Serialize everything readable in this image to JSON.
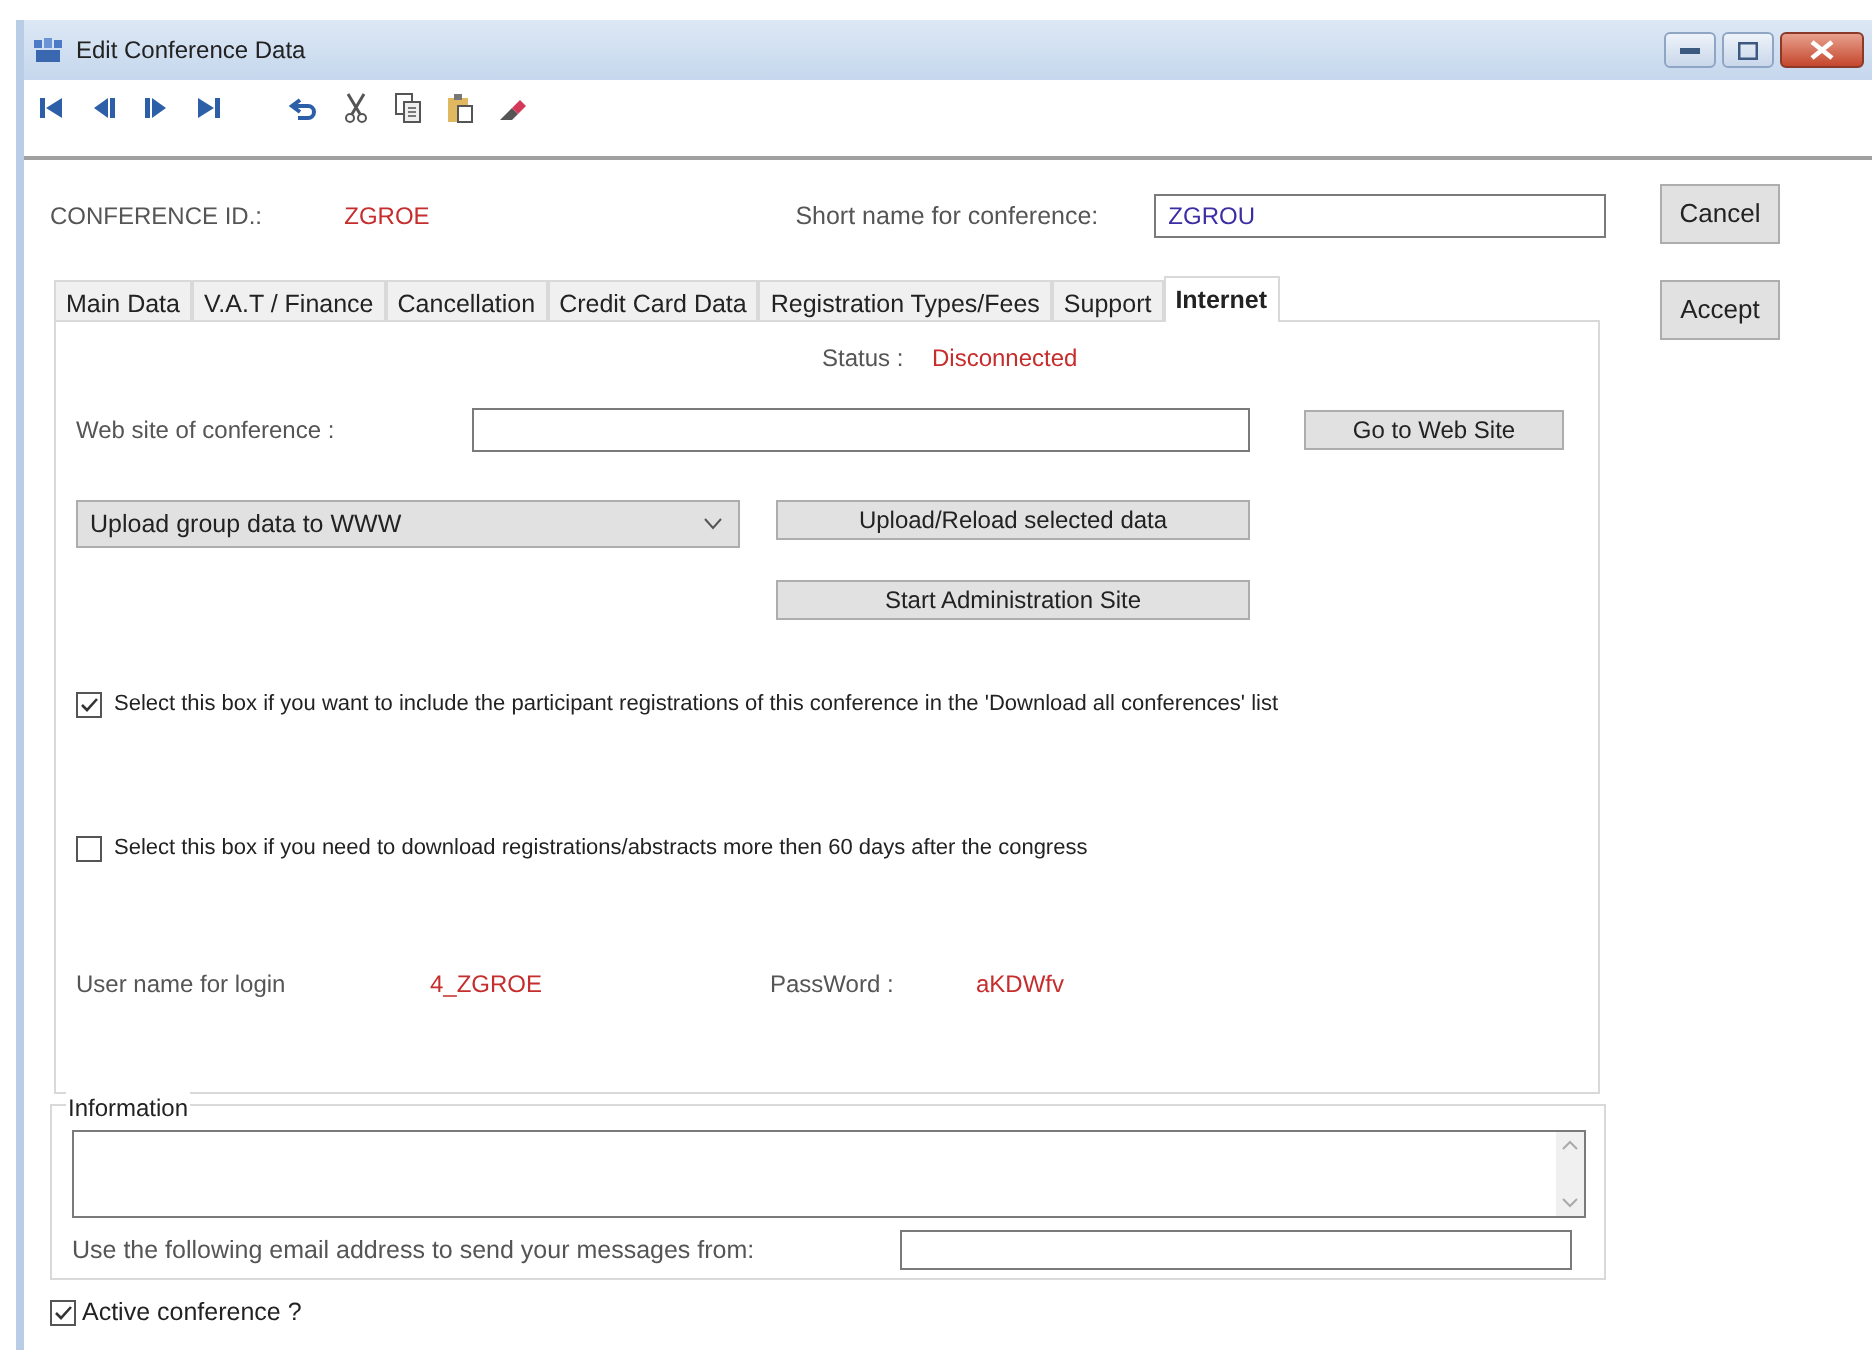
{
  "window": {
    "title": "Edit Conference Data"
  },
  "header": {
    "id_label": "CONFERENCE ID.:",
    "id_value": "ZGROE",
    "short_name_label": "Short name for conference:",
    "short_name_value": "ZGROU"
  },
  "side_buttons": [
    "Cancel",
    "Accept"
  ],
  "tabs": [
    {
      "label": "Main Data",
      "selected": false
    },
    {
      "label": "V.A.T / Finance",
      "selected": false
    },
    {
      "label": "Cancellation",
      "selected": false
    },
    {
      "label": "Credit Card Data",
      "selected": false
    },
    {
      "label": "Registration Types/Fees",
      "selected": false
    },
    {
      "label": "Support",
      "selected": false
    },
    {
      "label": "Internet",
      "selected": true
    }
  ],
  "internet": {
    "status_label": "Status :",
    "status_value": "Disconnected",
    "website_label": "Web site of conference :",
    "website_button": "Go to Web Site",
    "upload_select": "Upload group data to WWW",
    "upload_button": "Upload/Reload selected data",
    "admin_button": "Start Administration Site",
    "checkboxes": [
      {
        "label": "Select this box if you want to include the participant registrations of this conference in the 'Download all conferences' list",
        "checked": true
      },
      {
        "label": "Select this box if you need to download registrations/abstracts more then 60 days after the congress",
        "checked": false
      }
    ],
    "login_label": "User name for login",
    "login_value": "4_ZGROE",
    "password_label": "PassWord :",
    "password_value": "aKDWfv"
  },
  "information": {
    "legend": "Information",
    "email_label": "Use the following email address to send your messages from:"
  },
  "active_conference": {
    "label": "Active conference ?",
    "checked": true
  }
}
